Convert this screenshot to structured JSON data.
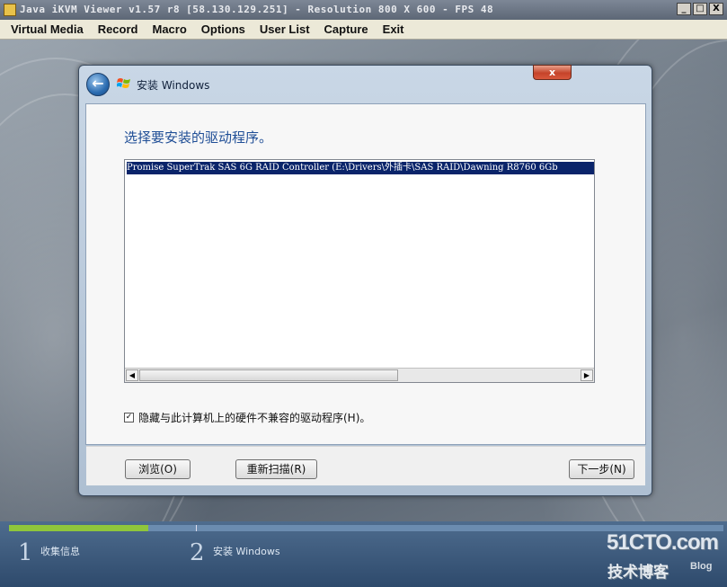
{
  "window": {
    "title": "Java iKVM Viewer v1.57 r8 [58.130.129.251] - Resolution 800 X 600 - FPS 48",
    "controls": {
      "minimize": "_",
      "maximize": "□",
      "close": "X"
    }
  },
  "menu": {
    "items": [
      "Virtual Media",
      "Record",
      "Macro",
      "Options",
      "User List",
      "Capture",
      "Exit"
    ]
  },
  "dialog": {
    "title": "安装 Windows",
    "close_glyph": "x",
    "back_glyph": "←",
    "heading": "选择要安装的驱动程序。",
    "drivers": [
      "Promise SuperTrak SAS 6G RAID Controller (E:\\Drivers\\外插卡\\SAS RAID\\Dawning R8760 6Gb"
    ],
    "hide_incompatible": {
      "checked": true,
      "check_glyph": "✓",
      "label": "隐藏与此计算机上的硬件不兼容的驱动程序(H)。"
    },
    "buttons": {
      "browse": "浏览(O)",
      "rescan": "重新扫描(R)",
      "next": "下一步(N)"
    }
  },
  "setup_progress": {
    "steps": [
      {
        "number": "1",
        "label": "收集信息"
      },
      {
        "number": "2",
        "label": "安装 Windows"
      }
    ]
  },
  "watermark": {
    "site": "51CTO.com",
    "tagline": "技术博客",
    "blog": "Blog"
  },
  "colors": {
    "selection": "#0a246a",
    "heading": "#1f4e96",
    "progress_fill": "#8fc63c"
  }
}
